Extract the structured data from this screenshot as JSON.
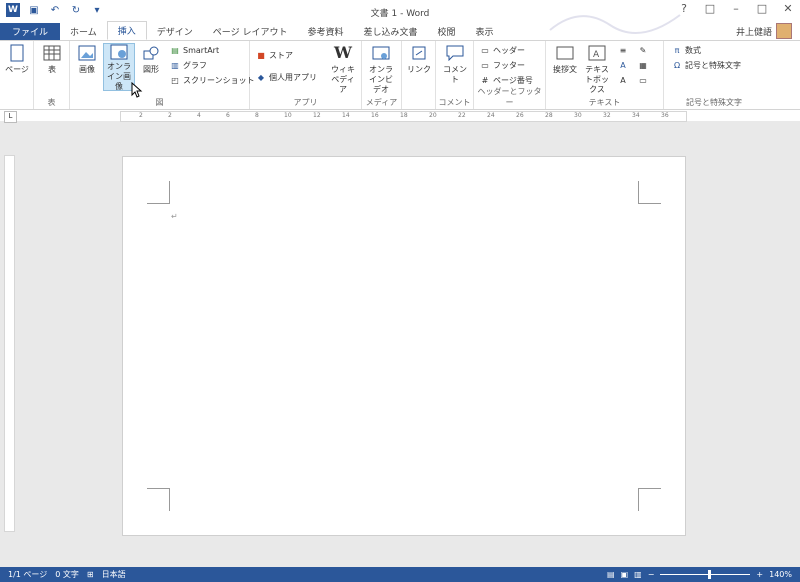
{
  "window": {
    "title": "文書 1 - Word",
    "controls": [
      "?",
      "□",
      "–",
      "□",
      "✕"
    ]
  },
  "tabs": {
    "file": "ファイル",
    "home": "ホーム",
    "insert": "挿入",
    "design": "デザイン",
    "layout": "ページ レイアウト",
    "references": "参考資料",
    "mailings": "差し込み文書",
    "review": "校閲",
    "view": "表示"
  },
  "user": {
    "name": "井上健語"
  },
  "ribbon": {
    "pages_label": "ページ",
    "table_label": "表",
    "table_group": "表",
    "picture_label": "画像",
    "online_picture_label": "オンライン画像",
    "shapes_label": "図形",
    "smartart_label": "SmartArt",
    "chart_label": "グラフ",
    "screenshot_label": "スクリーンショット",
    "illustrations_group": "図",
    "store_label": "ストア",
    "my_apps_label": "個人用アプリ",
    "wikipedia_label": "ウィキペディア",
    "apps_group": "アプリ",
    "online_video_label": "オンラインビデオ",
    "media_group": "メディア",
    "link_label": "リンク",
    "comment_label": "コメント",
    "comment_group": "コメント",
    "header_label": "ヘッダー",
    "footer_label": "フッター",
    "page_number_label": "ページ番号",
    "header_footer_group": "ヘッダーとフッター",
    "textbox_label": "テキストボックス",
    "quickparts_label": "挨拶文",
    "text_group": "テキスト",
    "equation_label": "数式",
    "symbol_label": "記号と特殊文字",
    "symbols_group": "記号と特殊文字"
  },
  "ruler": {
    "numbers": [
      "2",
      "2",
      "4",
      "6",
      "8",
      "10",
      "12",
      "14",
      "16",
      "18",
      "20",
      "22",
      "24",
      "26",
      "28",
      "30",
      "32",
      "34",
      "36"
    ]
  },
  "status": {
    "page": "1/1 ページ",
    "words": "0 文字",
    "language": "日本語",
    "zoom": "140%"
  },
  "colors": {
    "accent": "#2b579a"
  }
}
